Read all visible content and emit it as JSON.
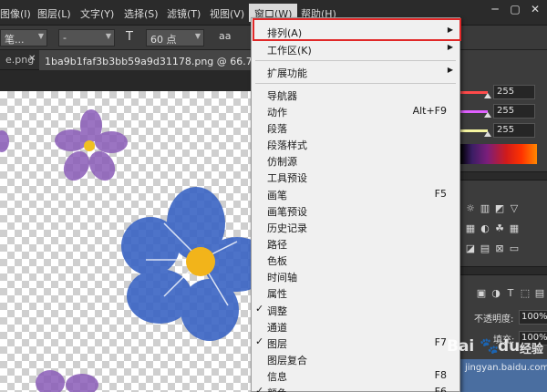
{
  "menubar": {
    "items": [
      {
        "label": "图像(I)"
      },
      {
        "label": "图层(L)"
      },
      {
        "label": "文字(Y)"
      },
      {
        "label": "选择(S)"
      },
      {
        "label": "滤镜(T)"
      },
      {
        "label": "视图(V)"
      },
      {
        "label": "窗口(W)"
      },
      {
        "label": "帮助(H)"
      }
    ],
    "window_controls": {
      "minimize": "─",
      "restore": "▢",
      "close": "✕"
    }
  },
  "options": {
    "font_family": "笔...",
    "font_style": "-",
    "font_size": "60 点",
    "aa_glyph": "aa"
  },
  "tabs": [
    {
      "label": "e.png"
    },
    {
      "label": "1ba9b1faf3b3bb59a9d31178.png @ 66.7% (图层"
    }
  ],
  "panel": {
    "rgb": [
      {
        "value": "255",
        "color": "#ff4a4a"
      },
      {
        "value": "255",
        "color": "#e060ff"
      },
      {
        "value": "255",
        "color": "#f5f5a0"
      }
    ],
    "opacity_label": "不透明度:",
    "opacity_value": "100%",
    "fill_label": "填充:",
    "fill_value": "100%"
  },
  "dropdown": {
    "items": [
      {
        "label": "排列(A)",
        "submenu": true
      },
      {
        "label": "工作区(K)",
        "submenu": true
      },
      {
        "label": "扩展功能",
        "submenu": true
      },
      {
        "label": "导航器"
      },
      {
        "label": "动作",
        "shortcut": "Alt+F9"
      },
      {
        "label": "段落"
      },
      {
        "label": "段落样式"
      },
      {
        "label": "仿制源"
      },
      {
        "label": "工具预设"
      },
      {
        "label": "画笔",
        "shortcut": "F5"
      },
      {
        "label": "画笔预设"
      },
      {
        "label": "历史记录"
      },
      {
        "label": "路径"
      },
      {
        "label": "色板"
      },
      {
        "label": "时间轴"
      },
      {
        "label": "属性"
      },
      {
        "label": "调整",
        "checked": true
      },
      {
        "label": "通道"
      },
      {
        "label": "图层",
        "shortcut": "F7",
        "checked": true
      },
      {
        "label": "图层复合"
      },
      {
        "label": "信息",
        "shortcut": "F8"
      },
      {
        "label": "颜色",
        "shortcut": "F6",
        "checked": true
      }
    ],
    "check_glyph": "✓",
    "submenu_glyph": "▶"
  },
  "watermark": {
    "main": "Bai",
    "paw": "du",
    "suffix": "经验",
    "url": "jingyan.baidu.com"
  },
  "colors": {
    "highlight": "#e02828",
    "menu_bg": "#f0f0f0",
    "app_bg": "#3c3c3c"
  }
}
